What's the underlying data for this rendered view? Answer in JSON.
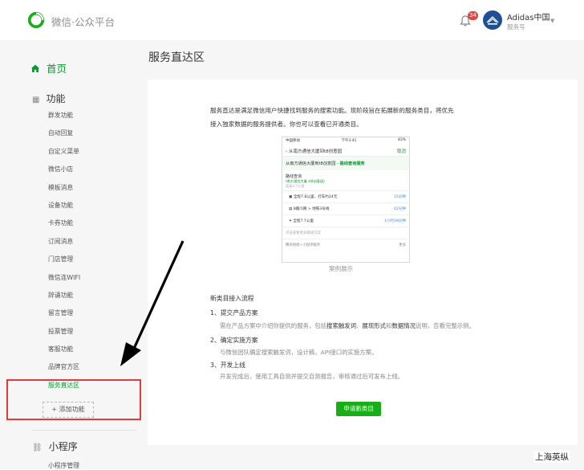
{
  "header": {
    "brand": "微信·公众平台",
    "notification_count": "34",
    "account_name": "Adidas中国",
    "account_type": "服务号"
  },
  "sidebar": {
    "home": "首页",
    "features_title": "功能",
    "items": [
      "群发功能",
      "自动回复",
      "自定义菜单",
      "微信小店",
      "模板消息",
      "设备功能",
      "卡券功能",
      "订阅消息",
      "门店管理",
      "微信连WIFI",
      "辞诵功能",
      "留言管理",
      "投票管理",
      "客服功能",
      "品牌官方区",
      "服务直达区"
    ],
    "active_item": "服务直达区",
    "add_function": "添加功能",
    "miniprogram_title": "小程序",
    "miniprogram_sub": "小程序管理"
  },
  "main": {
    "title": "服务直达区",
    "intro_line1": "服务直达是满足微信用户快捷找到服务的搜索功能。现阶段旨在拓展新的服务类目，将优先",
    "intro_line2": "接入独家数据的服务提供者。你也可以查看已开通类目。",
    "example_caption": "案例展示",
    "phone": {
      "carrier": "中国移动",
      "time": "下午3:41",
      "battery": "83%",
      "search_text": "从南方通信大厦到t8创意园",
      "cancel": "取消",
      "route_prefix": "从南方通信大厦到t8创意园 -",
      "route_label": "路线查询服务",
      "block_title": "路线查询",
      "block_sub": "(南方通信大厦→t8创意园)",
      "block_sub2": "距离3.7公里",
      "routes": [
        {
          "text": "全程7.8公里，打车约24元",
          "eta": "15分钟"
        },
        {
          "text": "8路/1路 > 地铁3号线",
          "eta": "42分钟"
        },
        {
          "text": "全程7.7公里",
          "eta": "1小时28分钟"
        }
      ],
      "more": "点击查看更多路线方案",
      "footer_left": "腾讯地图+小程序服务",
      "footer_right": "更多"
    },
    "process_title": "新类目接入流程",
    "steps": [
      {
        "title": "1、提交产品方案",
        "desc_prefix": "需在产品方案中介绍你提供的服务，包括",
        "desc_hl1": "搜索触发词",
        "desc_mid": "、",
        "desc_hl2": "展现形式",
        "desc_and": "和",
        "desc_hl3": "数据情况",
        "desc_suffix": "说明，告看完整示例。"
      },
      {
        "title": "2、确定实施方案",
        "desc": "与微信团队确定搜索触发词，设计稿，API接口的实施方案。"
      },
      {
        "title": "3、开发上线",
        "desc": "开发完成后，使用工具自测并提交自测报告，审核通过后可发布上线。"
      }
    ],
    "apply_button": "申请新类目"
  },
  "watermark": "上海英纵",
  "colors": {
    "accent": "#1aad19",
    "highlight_box": "#e23b3b",
    "badge": "#e64340"
  }
}
